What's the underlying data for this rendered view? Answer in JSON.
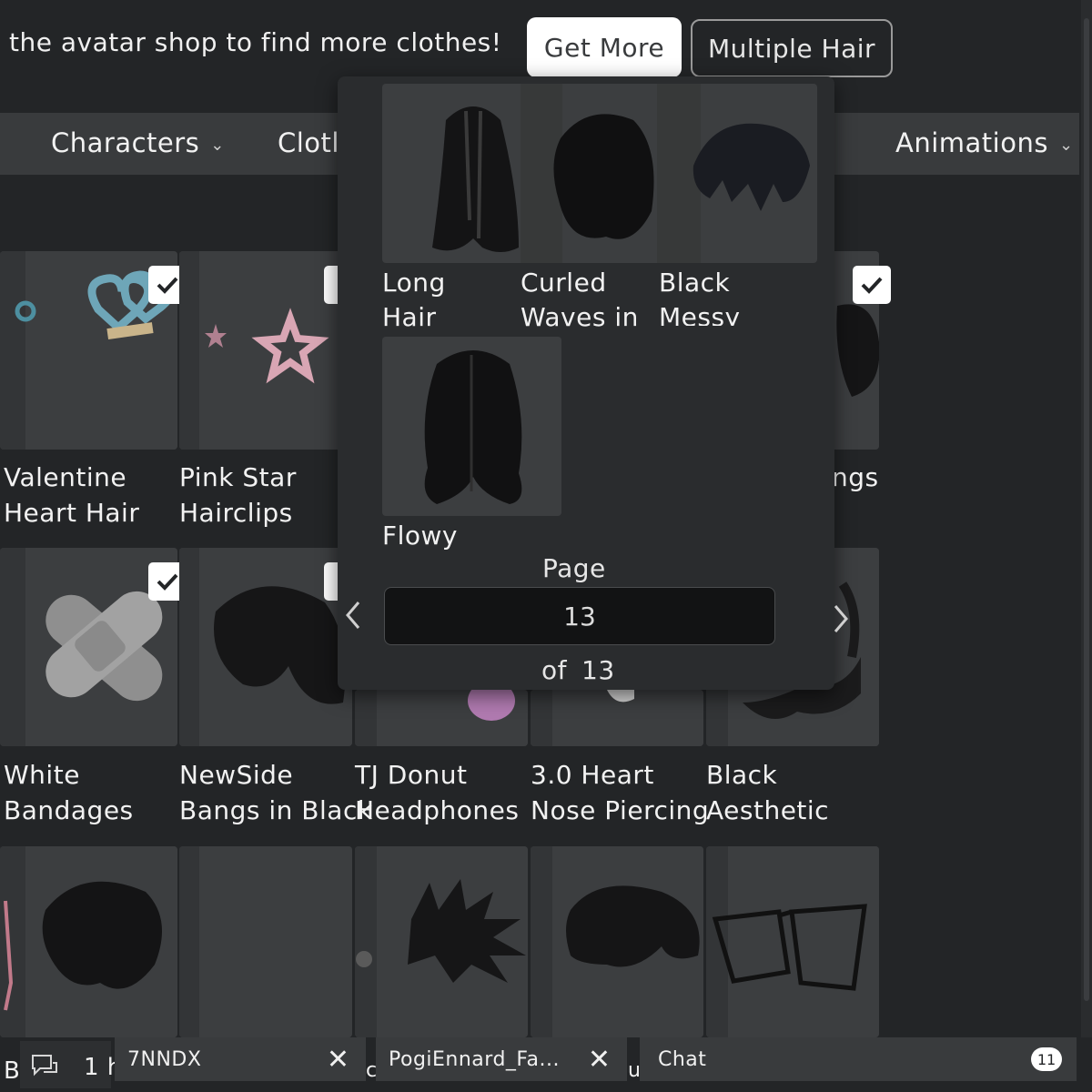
{
  "banner": {
    "text": "the avatar shop to find more clothes!",
    "get_more": "Get More",
    "multiple_hair": "Multiple Hair"
  },
  "categories": [
    {
      "label": "Characters"
    },
    {
      "label": "Clotl"
    },
    {
      "label": "Animations"
    }
  ],
  "grid": {
    "row1": [
      "Valentine\nHeart Hair",
      "Pink Star\nHairclips",
      "ngs"
    ],
    "row2": [
      "White\nBandages",
      "NewSide\nBangs in Black",
      "TJ Donut\nHeadphones",
      "3.0 Heart\nNose Piercing",
      "Black\nAesthetic"
    ]
  },
  "popup": {
    "items": [
      {
        "name": "Long\nHair",
        "icon": "long-hair-icon"
      },
      {
        "name": "Curled\nWaves in",
        "icon": "curled-hair-icon"
      },
      {
        "name": "Black\nMessy",
        "icon": "messy-hair-icon"
      },
      {
        "name": "Flowy",
        "icon": "flowy-hair-icon"
      }
    ],
    "page_label": "Page",
    "page_value": "13",
    "of_label": "of",
    "total_pages": "13"
  },
  "chatbar": {
    "left_partial": "B",
    "time_partial": "1 h",
    "tab1": "7NNDX",
    "tab2_prefix": "c",
    "tab2": "PogiEnnard_Fa...",
    "tab3_prefix": "u",
    "chat_label": "Chat",
    "unread": "11"
  },
  "colors": {
    "background": "#232527",
    "panel": "#393b3d",
    "popup": "#2a2c2e",
    "button_primary": "#ffffff"
  }
}
